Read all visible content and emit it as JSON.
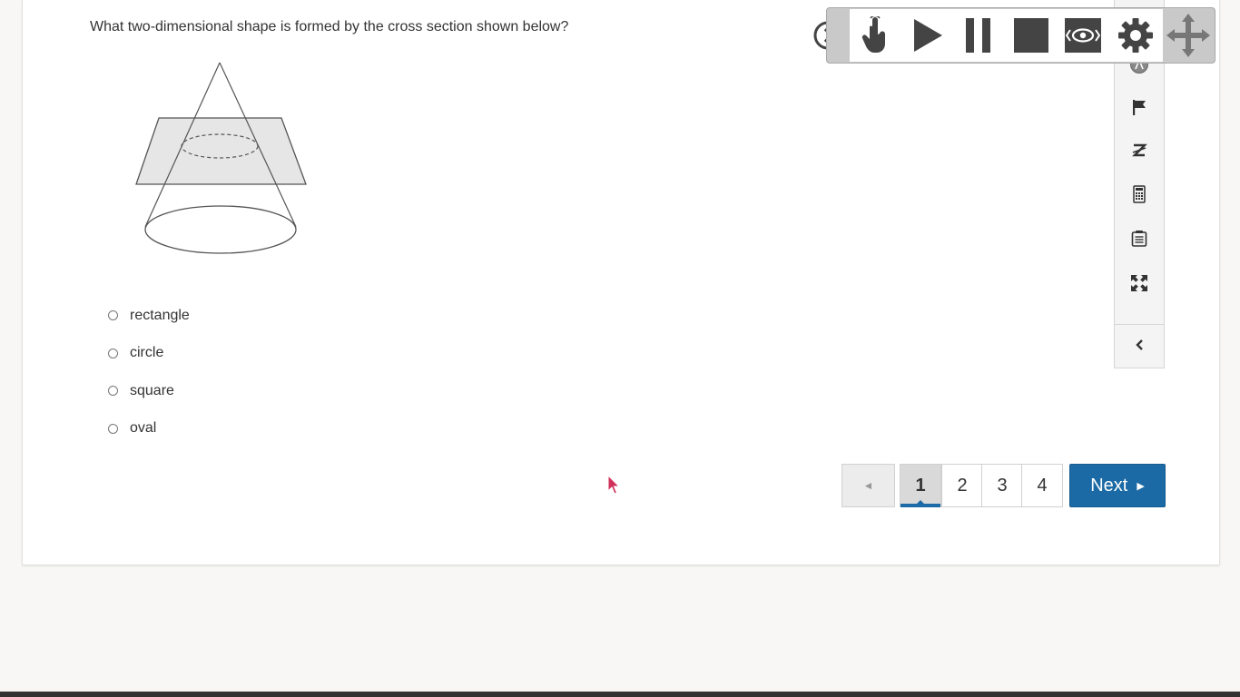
{
  "question": {
    "text": "What two-dimensional shape is formed by the cross section shown below?"
  },
  "options": [
    {
      "label": "rectangle"
    },
    {
      "label": "circle"
    },
    {
      "label": "square"
    },
    {
      "label": "oval"
    }
  ],
  "pagination": {
    "prev_label": "◄",
    "pages": [
      "1",
      "2",
      "3",
      "4"
    ],
    "current_page": "1",
    "next_label": "Next"
  },
  "side_tools": [
    {
      "icon": "accessibility-icon"
    },
    {
      "icon": "flag-icon"
    },
    {
      "icon": "eliminate-icon"
    },
    {
      "icon": "calculator-icon"
    },
    {
      "icon": "notepad-icon"
    },
    {
      "icon": "expand-icon"
    },
    {
      "icon": "chevron-left-icon"
    }
  ],
  "tts_toolbar": {
    "buttons": [
      {
        "icon": "pointer-hand-icon"
      },
      {
        "icon": "play-icon"
      },
      {
        "icon": "pause-icon"
      },
      {
        "icon": "stop-icon"
      },
      {
        "icon": "screen-mask-icon"
      },
      {
        "icon": "settings-gear-icon"
      }
    ]
  },
  "colors": {
    "primary": "#1b6aa5",
    "text": "#333333",
    "background": "#f8f7f6"
  }
}
